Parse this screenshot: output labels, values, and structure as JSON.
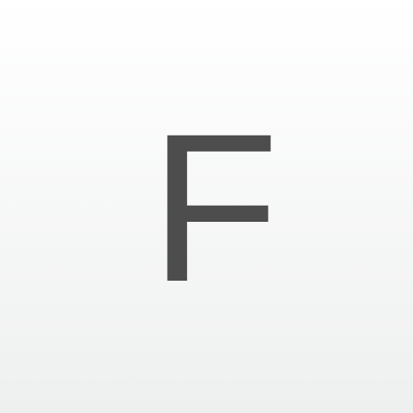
{
  "icon": {
    "letter": "F",
    "letter_color": "#4d4d4d",
    "background_top_color": "#ffffff",
    "background_bottom_color": "#eef0ef"
  }
}
